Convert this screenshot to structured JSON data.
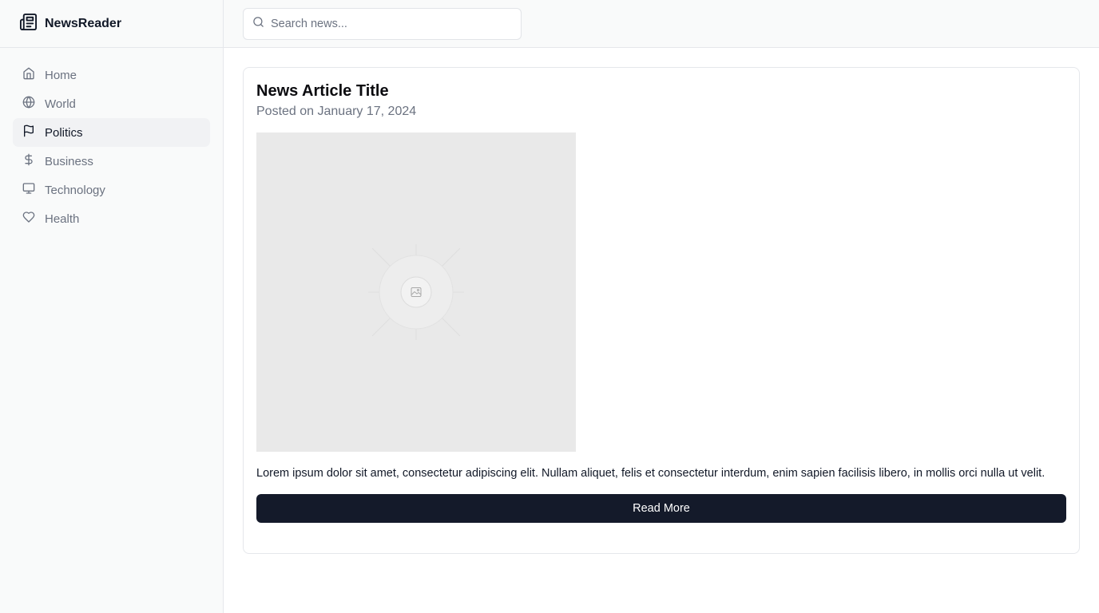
{
  "brand": {
    "name": "NewsReader",
    "icon": "newspaper-icon"
  },
  "search": {
    "placeholder": "Search news...",
    "value": ""
  },
  "nav": {
    "items": [
      {
        "label": "Home",
        "icon": "home-icon",
        "active": false
      },
      {
        "label": "World",
        "icon": "globe-icon",
        "active": false
      },
      {
        "label": "Politics",
        "icon": "flag-icon",
        "active": true
      },
      {
        "label": "Business",
        "icon": "dollar-icon",
        "active": false
      },
      {
        "label": "Technology",
        "icon": "monitor-icon",
        "active": false
      },
      {
        "label": "Health",
        "icon": "heart-icon",
        "active": false
      }
    ]
  },
  "article": {
    "title": "News Article Title",
    "date": "Posted on January 17, 2024",
    "body": "Lorem ipsum dolor sit amet, consectetur adipiscing elit. Nullam aliquet, felis et consectetur interdum, enim sapien facilisis libero, in mollis orci nulla ut velit.",
    "read_more_label": "Read More"
  },
  "colors": {
    "sidebar_bg": "#f9fafa",
    "active_bg": "#f1f2f4",
    "button_bg": "#141a2a",
    "muted_text": "#6b7280"
  }
}
